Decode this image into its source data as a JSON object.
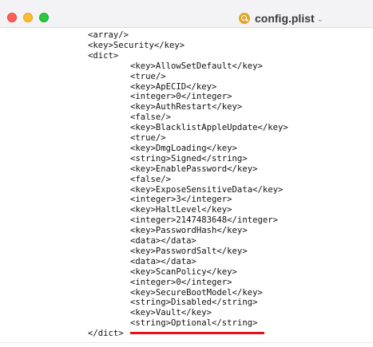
{
  "window": {
    "title": "config.plist",
    "title_menu_icon": "chevron-down-icon",
    "document_icon": "plist-document-icon"
  },
  "colors": {
    "close": "#ff5f57",
    "minimize": "#febc2e",
    "zoom": "#28c840",
    "highlight_underline": "#e8101a"
  },
  "code_lines": [
    {
      "text": "<array/>",
      "indent": 1
    },
    {
      "text": "<key>Security</key>",
      "indent": 1
    },
    {
      "text": "<dict>",
      "indent": 1
    },
    {
      "text": "<key>AllowSetDefault</key>",
      "indent": 2
    },
    {
      "text": "<true/>",
      "indent": 2
    },
    {
      "text": "<key>ApECID</key>",
      "indent": 2
    },
    {
      "text": "<integer>0</integer>",
      "indent": 2
    },
    {
      "text": "<key>AuthRestart</key>",
      "indent": 2
    },
    {
      "text": "<false/>",
      "indent": 2
    },
    {
      "text": "<key>BlacklistAppleUpdate</key>",
      "indent": 2
    },
    {
      "text": "<true/>",
      "indent": 2
    },
    {
      "text": "<key>DmgLoading</key>",
      "indent": 2
    },
    {
      "text": "<string>Signed</string>",
      "indent": 2
    },
    {
      "text": "<key>EnablePassword</key>",
      "indent": 2
    },
    {
      "text": "<false/>",
      "indent": 2
    },
    {
      "text": "<key>ExposeSensitiveData</key>",
      "indent": 2
    },
    {
      "text": "<integer>3</integer>",
      "indent": 2
    },
    {
      "text": "<key>HaltLevel</key>",
      "indent": 2
    },
    {
      "text": "<integer>2147483648</integer>",
      "indent": 2
    },
    {
      "text": "<key>PasswordHash</key>",
      "indent": 2
    },
    {
      "text": "<data></data>",
      "indent": 2
    },
    {
      "text": "<key>PasswordSalt</key>",
      "indent": 2
    },
    {
      "text": "<data></data>",
      "indent": 2
    },
    {
      "text": "<key>ScanPolicy</key>",
      "indent": 2
    },
    {
      "text": "<integer>0</integer>",
      "indent": 2
    },
    {
      "text": "<key>SecureBootModel</key>",
      "indent": 2
    },
    {
      "text": "<string>Disabled</string>",
      "indent": 2
    },
    {
      "text": "<key>Vault</key>",
      "indent": 2
    },
    {
      "text": "<string>Optional</string>",
      "indent": 2,
      "highlighted": true
    },
    {
      "text": "</dict>",
      "indent": 1
    }
  ]
}
